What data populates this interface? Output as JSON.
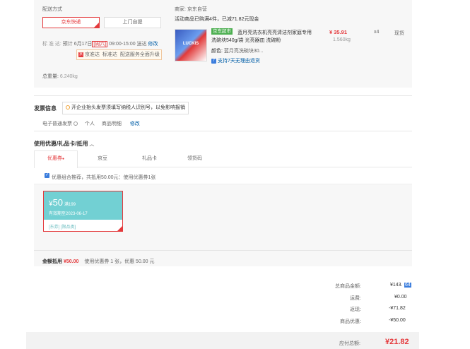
{
  "shipping": {
    "section_label": "配送方式",
    "options": [
      "京东快递",
      "上门自提"
    ],
    "schedule_prefix": "标 准 达:",
    "schedule_date": "预计 6月17日",
    "schedule_day": "[周六]",
    "schedule_time": "09:00-15:00 送达",
    "schedule_edit": "修改",
    "service_badges": [
      "京准达",
      "标准达",
      "配送服务全面升级"
    ],
    "total_weight_label": "总重量:",
    "total_weight_value": "6.240kg"
  },
  "merchant": {
    "label": "商家:",
    "name": "京东自营",
    "promo_prefix": "活动商品已购满4件，已减",
    "promo_amount": "71.82",
    "promo_suffix": "元现金"
  },
  "product": {
    "store_tag": "京东超市",
    "title_line1": "蓝月亮洗衣机亮亮清洁剂家庭专用",
    "title_line2": "洗碗块540g/袋 光亮器皿 洗碗粉",
    "price": "¥ 35.91",
    "weight": "1.560kg",
    "quantity": "x4",
    "stock": "现货",
    "color_label": "颜色:",
    "color_value": "蓝月亮洗碗块30...",
    "service_note": "支持7天无理由退货",
    "image_text": "LUCKIS"
  },
  "invoice": {
    "title": "发票信息",
    "tip": "开企业抬头发票须填写纳税人识别号，以免影响报销",
    "type": "电子普通发票",
    "type_icon": "info-icon",
    "recipient": "个人",
    "content": "商品明细",
    "edit": "修改"
  },
  "coupons": {
    "title": "使用优惠/礼品卡/抵用",
    "tabs": [
      "优惠券",
      "京豆",
      "礼品卡",
      "领货码"
    ],
    "recommend_text": "优惠组合推荐，共抵用50.00元：使用优惠券1张",
    "card": {
      "currency": "¥",
      "amount": "50",
      "condition": "满199",
      "expiry": "有效期至2023-06-17",
      "scope": "[东券] [限品类]"
    },
    "summary_label": "金额抵用",
    "summary_amount": "¥50.00",
    "summary_detail": "使用优惠券 1 张，优惠 50.00 元"
  },
  "totals": {
    "rows": [
      {
        "label": "总商品金额:",
        "value": "¥143.",
        "badge": "64"
      },
      {
        "label": "运费:",
        "value": "¥0.00"
      },
      {
        "label": "返现:",
        "value": "-¥71.82"
      },
      {
        "label": "商品优惠:",
        "value": "-¥50.00"
      }
    ],
    "payable_label": "应付总额:",
    "payable_value": "¥21.82"
  },
  "colors": {
    "accent": "#e4393c",
    "link": "#005ea7",
    "coupon_card": "#72d0d3",
    "tag_green": "#4caf50",
    "badge_blue": "#3b7ddd"
  }
}
